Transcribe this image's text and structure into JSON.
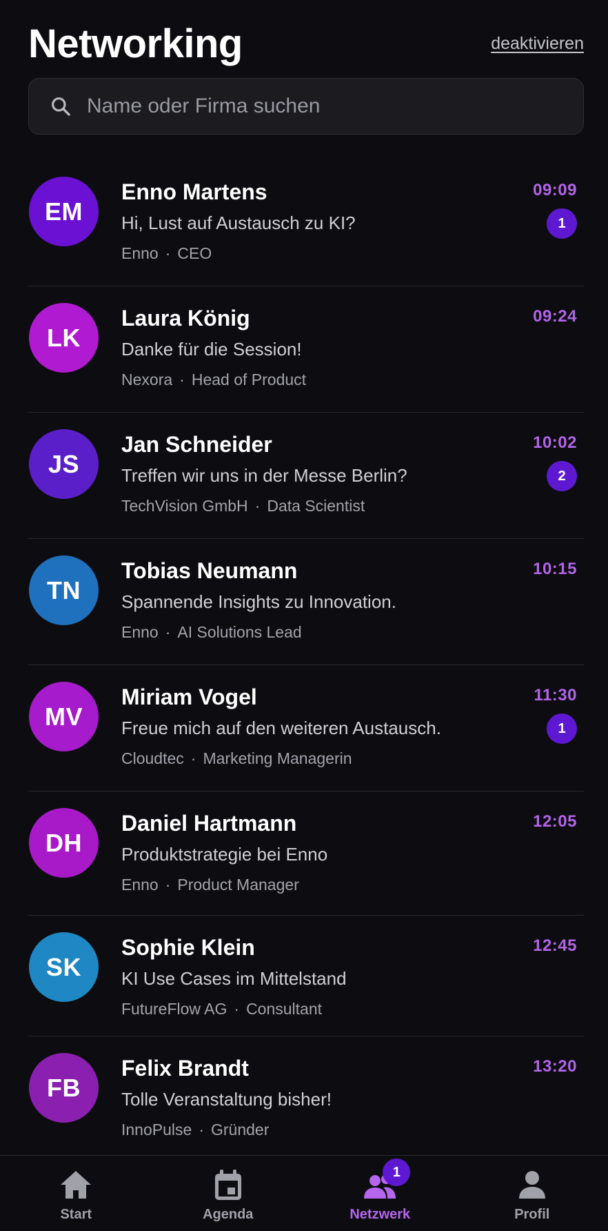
{
  "header": {
    "title": "Networking",
    "deactivate_label": "deaktivieren"
  },
  "search": {
    "placeholder": "Name oder Firma suchen",
    "value": ""
  },
  "colors": {
    "accent": "#b264e8",
    "badge": "#5e18d2",
    "background": "#0d0d11"
  },
  "conversations": [
    {
      "initials": "EM",
      "name": "Enno Martens",
      "message": "Hi, Lust auf Austausch zu KI?",
      "company": "Enno",
      "role": "CEO",
      "time": "09:09",
      "unread": "1",
      "avatar_color": "#6a11d3"
    },
    {
      "initials": "LK",
      "name": "Laura König",
      "message": "Danke für die Session!",
      "company": "Nexora",
      "role": "Head of Product",
      "time": "09:24",
      "unread": "",
      "avatar_color": "#b01ad1"
    },
    {
      "initials": "JS",
      "name": "Jan Schneider",
      "message": "Treffen wir uns in der Messe Berlin?",
      "company": "TechVision GmbH",
      "role": "Data Scientist",
      "time": "10:02",
      "unread": "2",
      "avatar_color": "#5a1fc9"
    },
    {
      "initials": "TN",
      "name": "Tobias Neumann",
      "message": "Spannende Insights zu Innovation.",
      "company": "Enno",
      "role": "AI Solutions Lead",
      "time": "10:15",
      "unread": "",
      "avatar_color": "#1f70bd"
    },
    {
      "initials": "MV",
      "name": "Miriam Vogel",
      "message": "Freue mich auf den weiteren Austausch.",
      "company": "Cloudtec",
      "role": "Marketing Managerin",
      "time": "11:30",
      "unread": "1",
      "avatar_color": "#a61bcc"
    },
    {
      "initials": "DH",
      "name": "Daniel Hartmann",
      "message": "Produktstrategie bei Enno",
      "company": "Enno",
      "role": "Product Manager",
      "time": "12:05",
      "unread": "",
      "avatar_color": "#a81ac8"
    },
    {
      "initials": "SK",
      "name": "Sophie Klein",
      "message": "KI Use Cases im Mittelstand",
      "company": "FutureFlow AG",
      "role": "Consultant",
      "time": "12:45",
      "unread": "",
      "avatar_color": "#1e87c4"
    },
    {
      "initials": "FB",
      "name": "Felix Brandt",
      "message": "Tolle Veranstaltung bisher!",
      "company": "InnoPulse",
      "role": "Gründer",
      "time": "13:20",
      "unread": "",
      "avatar_color": "#8b1fb0"
    }
  ],
  "separator": "·",
  "tabbar": {
    "items": [
      {
        "label": "Start",
        "icon": "home-icon",
        "active": false
      },
      {
        "label": "Agenda",
        "icon": "calendar-icon",
        "active": false
      },
      {
        "label": "Netzwerk",
        "icon": "people-icon",
        "active": true,
        "badge": "1"
      },
      {
        "label": "Profil",
        "icon": "person-icon",
        "active": false
      }
    ]
  }
}
